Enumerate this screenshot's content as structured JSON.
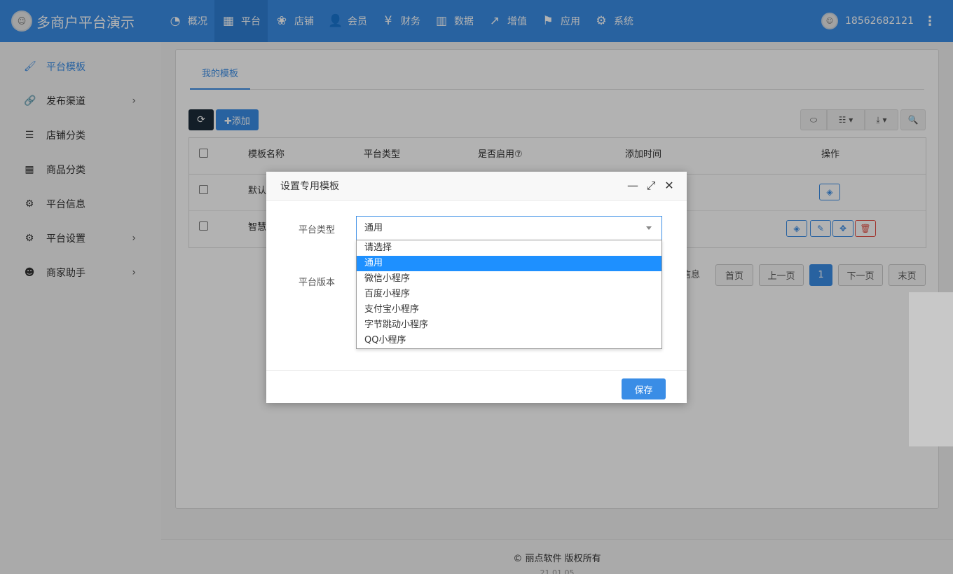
{
  "brand": {
    "name": "多商户平台演示",
    "logo_icon": "chef-avatar-icon"
  },
  "nav": [
    {
      "label": "概况",
      "icon": "dashboard-icon",
      "glyph": "◔"
    },
    {
      "label": "平台",
      "icon": "grid-icon",
      "glyph": "▦"
    },
    {
      "label": "店铺",
      "icon": "paw-icon",
      "glyph": "❀"
    },
    {
      "label": "会员",
      "icon": "user-plus-icon",
      "glyph": "👤"
    },
    {
      "label": "财务",
      "icon": "yen-icon",
      "glyph": "¥"
    },
    {
      "label": "数据",
      "icon": "bar-chart-icon",
      "glyph": "▥"
    },
    {
      "label": "增值",
      "icon": "line-chart-icon",
      "glyph": "↗"
    },
    {
      "label": "应用",
      "icon": "flag-icon",
      "glyph": "⚑"
    },
    {
      "label": "系统",
      "icon": "gear-icon",
      "glyph": "⚙"
    }
  ],
  "user": {
    "phone": "18562682121",
    "more": "⋮"
  },
  "sidebar": [
    {
      "label": "平台模板",
      "glyph": "🖌",
      "active": true,
      "arrow": ""
    },
    {
      "label": "发布渠道",
      "glyph": "🔗",
      "active": false,
      "arrow": "›"
    },
    {
      "label": "店铺分类",
      "glyph": "☰",
      "active": false,
      "arrow": ""
    },
    {
      "label": "商品分类",
      "glyph": "▦",
      "active": false,
      "arrow": ""
    },
    {
      "label": "平台信息",
      "glyph": "⚙",
      "active": false,
      "arrow": ""
    },
    {
      "label": "平台设置",
      "glyph": "⚙",
      "active": false,
      "arrow": "›"
    },
    {
      "label": "商家助手",
      "glyph": "☻",
      "active": false,
      "arrow": "›"
    }
  ],
  "tabs": {
    "my_templates": "我的模板"
  },
  "toolbar": {
    "refresh_glyph": "⟳",
    "add_label": "✚添加",
    "toggle_glyph": "⬭",
    "columns_glyph": "☷ ▾",
    "export_glyph": "⤓ ▾",
    "search_glyph": "🔍"
  },
  "table": {
    "headers": [
      "模板名称",
      "平台类型",
      "是否启用⑦",
      "添加时间",
      "操作"
    ],
    "rows": [
      {
        "name": "默认"
      },
      {
        "name": "智慧"
      }
    ]
  },
  "pager": {
    "info": "信息",
    "first": "首页",
    "prev": "上一页",
    "current": "1",
    "next": "下一页",
    "last": "末页"
  },
  "modal": {
    "title": "设置专用模板",
    "minimize": "—",
    "maximize": "⤢",
    "close": "✕",
    "platform_type_label": "平台类型",
    "platform_type_value": "通用",
    "platform_version_label": "平台版本",
    "options": [
      "请选择",
      "通用",
      "微信小程序",
      "百度小程序",
      "支付宝小程序",
      "字节跳动小程序",
      "QQ小程序"
    ],
    "selected_index": 1,
    "save_label": "保存"
  },
  "footer": {
    "copyright": "© 丽点软件 版权所有",
    "version": "21.01.05"
  },
  "colors": {
    "primary": "#3a8de6",
    "dark": "#1c2b3a",
    "danger": "#e54d42",
    "option_selected": "#1e90ff"
  }
}
